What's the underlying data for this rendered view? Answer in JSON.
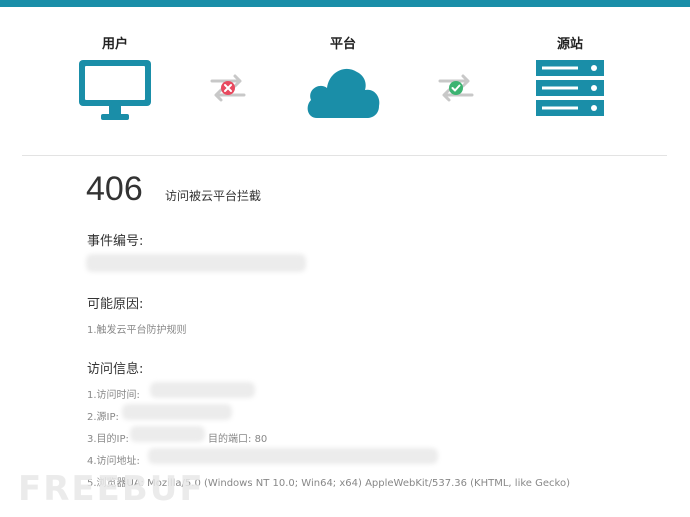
{
  "colors": {
    "accent": "#1a8ea8",
    "error": "#e84a5f",
    "ok": "#3cb371"
  },
  "flow": {
    "user": {
      "label": "用户",
      "icon": "monitor-icon"
    },
    "platform": {
      "label": "平台",
      "icon": "cloud-icon"
    },
    "origin": {
      "label": "源站",
      "icon": "server-icon"
    },
    "arrow_left": {
      "icon": "swap-blocked-icon",
      "status": "blocked"
    },
    "arrow_right": {
      "icon": "swap-ok-icon",
      "status": "ok"
    }
  },
  "error": {
    "code": "406",
    "message": "访问被云平台拦截"
  },
  "event": {
    "title": "事件编号:"
  },
  "reason": {
    "title": "可能原因:",
    "item1": "1.触发云平台防护规则"
  },
  "access": {
    "title": "访问信息:",
    "time_label": "1.访问时间:",
    "source_ip_label": "2.源IP:",
    "dest_ip_label": "3.目的IP:",
    "dest_port_label": "目的端口:",
    "dest_port_value": "80",
    "url_label": "4.访问地址:",
    "ua_label": "5.浏览器UA:",
    "ua_value": "Mozilla/5.0 (Windows NT 10.0; Win64; x64) AppleWebKit/537.36 (KHTML, like Gecko)"
  },
  "watermark": {
    "text": "FREEBUF"
  }
}
